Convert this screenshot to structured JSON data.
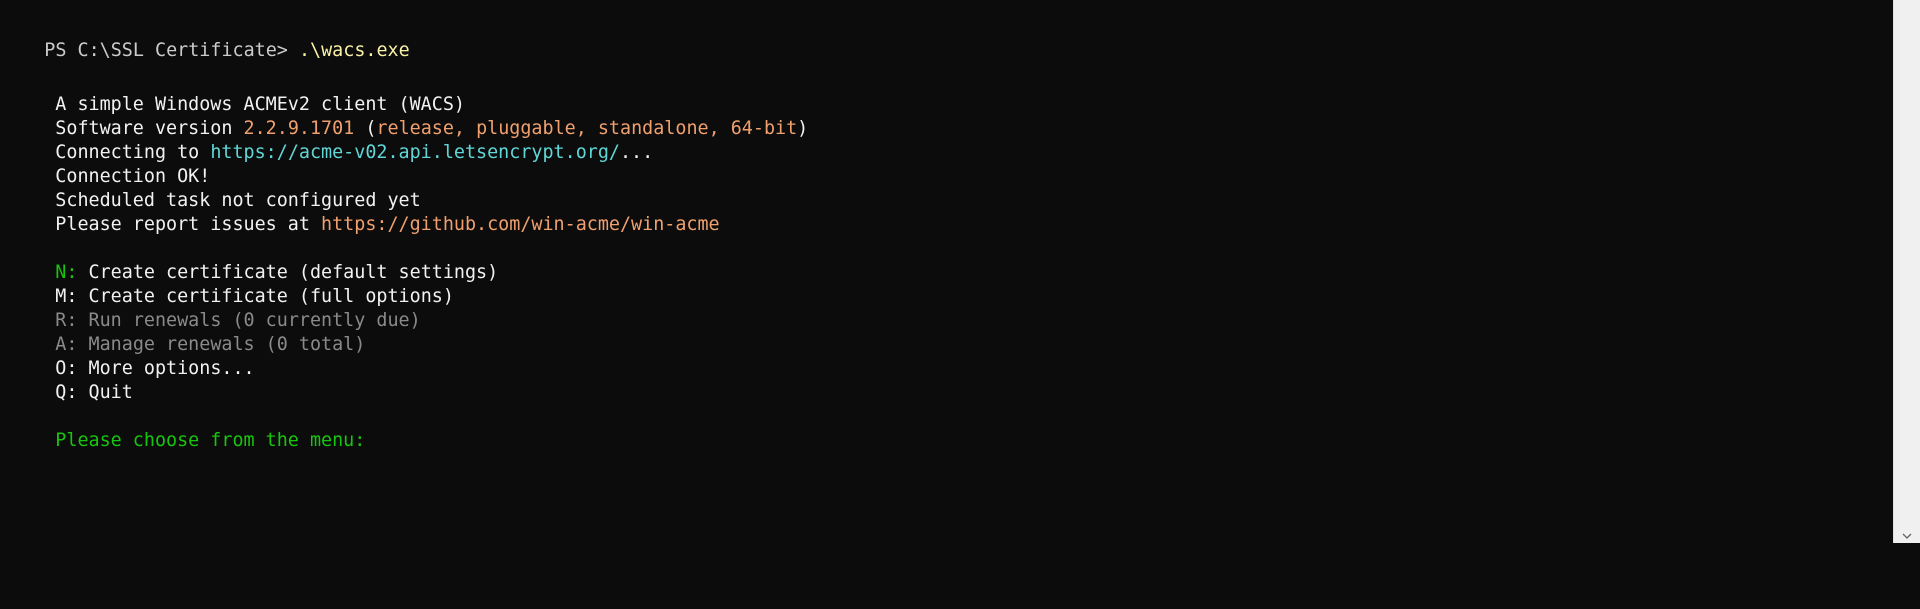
{
  "terminal": {
    "prompt": {
      "path": "PS C:\\SSL Certificate> ",
      "command": ".\\wacs.exe"
    },
    "header": {
      "title": "A simple Windows ACMEv2 client (WACS)",
      "version_prefix": "Software version ",
      "version_number": "2.2.9.1701",
      "version_details_open": " (",
      "version_details": "release, pluggable, standalone, 64-bit",
      "version_details_close": ")",
      "connecting_prefix": "Connecting to ",
      "connecting_url": "https://acme-v02.api.letsencrypt.org/",
      "connecting_suffix": "...",
      "connection_status": "Connection OK!",
      "scheduled_task": "Scheduled task not configured yet",
      "report_prefix": "Please report issues at ",
      "report_url": "https://github.com/win-acme/win-acme"
    },
    "menu": [
      {
        "key": "N:",
        "label": " Create certificate (default settings)"
      },
      {
        "key": "M:",
        "label": " Create certificate (full options)"
      },
      {
        "key": "R:",
        "label": " Run renewals (0 currently due)"
      },
      {
        "key": "A:",
        "label": " Manage renewals (0 total)"
      },
      {
        "key": "O:",
        "label": " More options..."
      },
      {
        "key": "Q:",
        "label": " Quit"
      }
    ],
    "menu_prompt": "Please choose from the menu:"
  },
  "colors": {
    "background": "#0c0c0c",
    "text": "#cccccc",
    "yellow": "#f9f1a5",
    "orange": "#f0a06e",
    "cyan": "#61d6d6",
    "green": "#16c60c",
    "disabled": "#8a8a8a"
  },
  "icons": {
    "scroll_down": "chevron-down-icon"
  }
}
